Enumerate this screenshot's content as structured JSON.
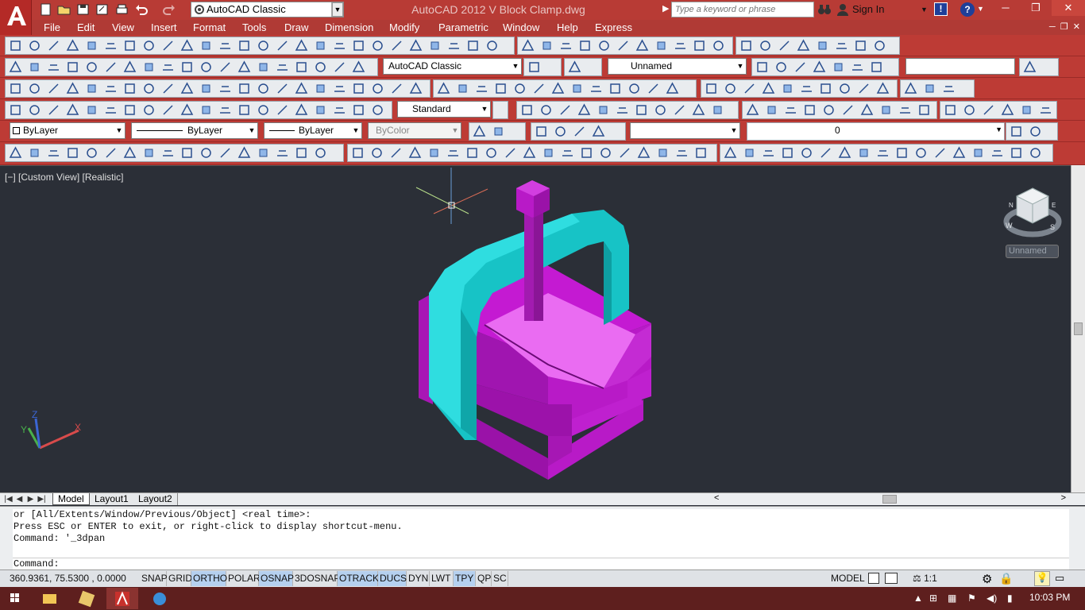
{
  "title_bar": {
    "workspace": "AutoCAD Classic",
    "title": "AutoCAD 2012    V Block Clamp.dwg",
    "search_placeholder": "Type a keyword or phrase",
    "sign_in": "Sign In"
  },
  "menu": [
    "File",
    "Edit",
    "View",
    "Insert",
    "Format",
    "Tools",
    "Draw",
    "Dimension",
    "Modify",
    "Parametric",
    "Window",
    "Help",
    "Express"
  ],
  "toolbars": {
    "workspace_combo": "AutoCAD Classic",
    "view_combo": "Unnamed",
    "text_style": "Standard",
    "layer_color": "ByLayer",
    "layer_linetype": "ByLayer",
    "layer_lineweight": "ByLayer",
    "plot_style": "ByColor",
    "layer_name": "0"
  },
  "viewport": {
    "label": "[−] [Custom View] [Realistic]",
    "view_name": "Unnamed",
    "viewcube_compass": [
      "W",
      "S",
      "E",
      "N"
    ],
    "ucs_axes": [
      "X",
      "Y",
      "Z"
    ]
  },
  "layout_tabs": [
    "Model",
    "Layout1",
    "Layout2"
  ],
  "command": {
    "history": [
      "or [All/Extents/Window/Previous/Object] <real time>:",
      "Press ESC or ENTER to exit, or right-click to display shortcut-menu.",
      "Command: '_3dpan"
    ],
    "prompt": "Command:"
  },
  "status": {
    "coords": "360.9361, 75.5300 , 0.0000",
    "toggles": [
      {
        "label": "SNAP",
        "on": false
      },
      {
        "label": "GRID",
        "on": false
      },
      {
        "label": "ORTHO",
        "on": true
      },
      {
        "label": "POLAR",
        "on": false
      },
      {
        "label": "OSNAP",
        "on": true
      },
      {
        "label": "3DOSNAP",
        "on": false
      },
      {
        "label": "OTRACK",
        "on": true
      },
      {
        "label": "DUCS",
        "on": true
      },
      {
        "label": "DYN",
        "on": false
      },
      {
        "label": "LWT",
        "on": false
      },
      {
        "label": "TPY",
        "on": true
      },
      {
        "label": "QP",
        "on": false
      },
      {
        "label": "SC",
        "on": false
      }
    ],
    "space": "MODEL",
    "annotation_scale": "1:1"
  },
  "taskbar": {
    "time": "10:03 PM"
  },
  "colors": {
    "title_bar": "#b83b35",
    "toolbar_bg": "#bd3b35",
    "viewport_bg": "#2b2f37",
    "clamp_frame": "#17c3c6",
    "v_block": "#b81ac7",
    "v_top": "#ea6cf2",
    "status_on": "#b5d0ef"
  }
}
